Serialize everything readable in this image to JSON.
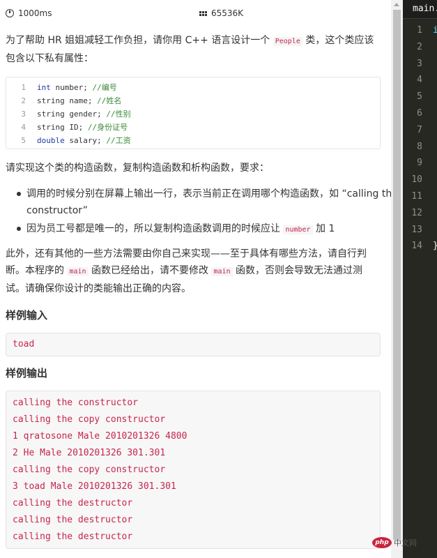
{
  "meta": {
    "time_limit": "1000ms",
    "memory_limit": "65536K"
  },
  "intro": {
    "part1": "为了帮助 HR 姐姐减轻工作负担，请你用 C++ 语言设计一个",
    "class_name": "People",
    "part2": "类，这个类应该包含以下私有属性："
  },
  "code_block": [
    {
      "num": "1",
      "type": "int",
      "type_is_keyword": true,
      "rest": " number; ",
      "comment": "//编号"
    },
    {
      "num": "2",
      "type": "string",
      "type_is_keyword": false,
      "rest": " name; ",
      "comment": "//姓名"
    },
    {
      "num": "3",
      "type": "string",
      "type_is_keyword": false,
      "rest": " gender; ",
      "comment": "//性别"
    },
    {
      "num": "4",
      "type": "string",
      "type_is_keyword": false,
      "rest": " ID; ",
      "comment": "//身份证号"
    },
    {
      "num": "5",
      "type": "double",
      "type_is_keyword": true,
      "rest": " salary; ",
      "comment": "//工资"
    }
  ],
  "requirements_intro": "请实现这个类的构造函数，复制构造函数和析构函数，要求：",
  "requirements": {
    "item1": "调用的时候分别在屏幕上输出一行，表示当前正在调用哪个构造函数，如 “calling the constructor”",
    "item2_part1": "因为员工号都是唯一的，所以复制构造函数调用的时候应让",
    "item2_code": "number",
    "item2_part2": "加 1"
  },
  "note": {
    "part1": "此外，还有其他的一些方法需要由你自己来实现——至于具体有哪些方法，请自行判断。本程序的",
    "code1": "main",
    "part2": "函数已经给出，请不要修改",
    "code2": "main",
    "part3": "函数，否则会导致无法通过测试。请确保你设计的类能输出正确的内容。"
  },
  "sample_input_heading": "样例输入",
  "sample_input": [
    "toad"
  ],
  "sample_output_heading": "样例输出",
  "sample_output": [
    "calling the constructor",
    "calling the copy constructor",
    "1 qratosone Male 2010201326 4800",
    "2 He Male 2010201326 301.301",
    "calling the copy constructor",
    "3 toad Male 2010201326 301.301",
    "calling the destructor",
    "calling the destructor",
    "calling the destructor"
  ],
  "editor": {
    "tab_label": "main.c",
    "line_numbers": [
      "1",
      "2",
      "3",
      "4",
      "5",
      "6",
      "7",
      "8",
      "9",
      "10",
      "11",
      "12",
      "13",
      "14"
    ],
    "line1_fragment": "i",
    "line14_fragment": "}"
  },
  "watermark": {
    "logo_text": "php",
    "site_text": "中文网"
  }
}
